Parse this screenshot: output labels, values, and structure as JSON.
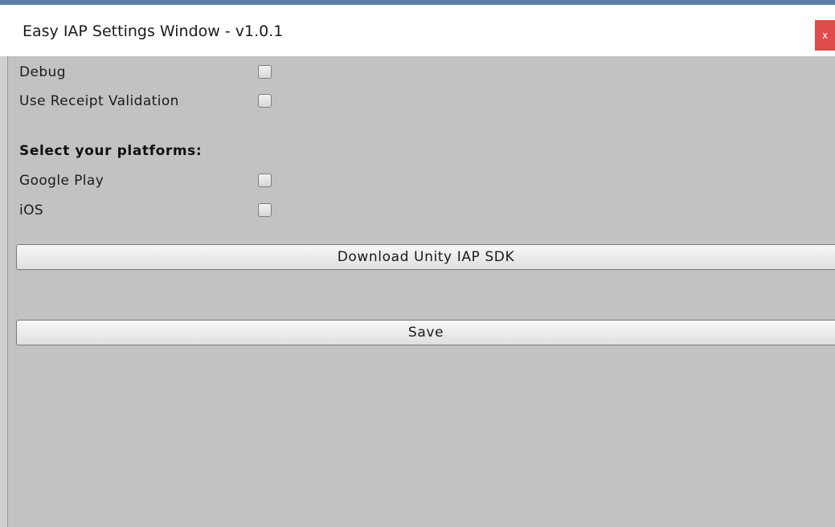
{
  "window": {
    "title": "Easy IAP Settings Window - v1.0.1",
    "close_label": "x"
  },
  "settings": {
    "debug": {
      "label": "Debug",
      "checked": false
    },
    "receipt_validation": {
      "label": "Use Receipt Validation",
      "checked": false
    }
  },
  "platforms": {
    "heading": "Select your platforms:",
    "google_play": {
      "label": "Google Play",
      "checked": false
    },
    "ios": {
      "label": "iOS",
      "checked": false
    }
  },
  "buttons": {
    "download_label": "Download Unity IAP SDK",
    "save_label": "Save"
  },
  "colors": {
    "panel_bg": "#c2c2c2",
    "titlebar_bg": "#ffffff",
    "close_bg": "#e04b4b"
  }
}
